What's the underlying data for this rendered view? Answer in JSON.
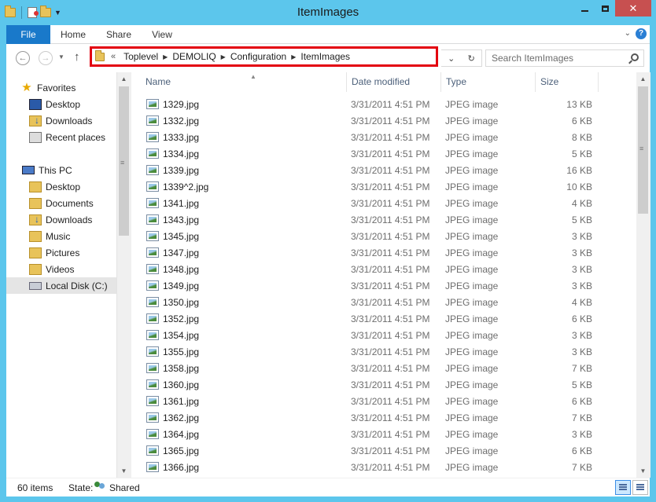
{
  "window": {
    "title": "ItemImages",
    "controls": {
      "minimize": "–",
      "maximize": "□",
      "close": "✕"
    }
  },
  "ribbon": {
    "tabs": [
      "File",
      "Home",
      "Share",
      "View"
    ],
    "expand_glyph": "⌄",
    "help_glyph": "?"
  },
  "address": {
    "overflow": "«",
    "crumbs": [
      "Toplevel",
      "DEMOLIQ",
      "Configuration",
      "ItemImages"
    ],
    "search_placeholder": "Search ItemImages",
    "highlight_color": "#e3000f"
  },
  "nav": {
    "favorites_label": "Favorites",
    "favorites": [
      "Desktop",
      "Downloads",
      "Recent places"
    ],
    "this_pc_label": "This PC",
    "this_pc": [
      "Desktop",
      "Documents",
      "Downloads",
      "Music",
      "Pictures",
      "Videos",
      "Local Disk (C:)"
    ],
    "selected": "Local Disk (C:)"
  },
  "columns": {
    "name": "Name",
    "date": "Date modified",
    "type": "Type",
    "size": "Size"
  },
  "files": [
    {
      "name": "1329.jpg",
      "date": "3/31/2011 4:51 PM",
      "type": "JPEG image",
      "size": "13 KB"
    },
    {
      "name": "1332.jpg",
      "date": "3/31/2011 4:51 PM",
      "type": "JPEG image",
      "size": "6 KB"
    },
    {
      "name": "1333.jpg",
      "date": "3/31/2011 4:51 PM",
      "type": "JPEG image",
      "size": "8 KB"
    },
    {
      "name": "1334.jpg",
      "date": "3/31/2011 4:51 PM",
      "type": "JPEG image",
      "size": "5 KB"
    },
    {
      "name": "1339.jpg",
      "date": "3/31/2011 4:51 PM",
      "type": "JPEG image",
      "size": "16 KB"
    },
    {
      "name": "1339^2.jpg",
      "date": "3/31/2011 4:51 PM",
      "type": "JPEG image",
      "size": "10 KB"
    },
    {
      "name": "1341.jpg",
      "date": "3/31/2011 4:51 PM",
      "type": "JPEG image",
      "size": "4 KB"
    },
    {
      "name": "1343.jpg",
      "date": "3/31/2011 4:51 PM",
      "type": "JPEG image",
      "size": "5 KB"
    },
    {
      "name": "1345.jpg",
      "date": "3/31/2011 4:51 PM",
      "type": "JPEG image",
      "size": "3 KB"
    },
    {
      "name": "1347.jpg",
      "date": "3/31/2011 4:51 PM",
      "type": "JPEG image",
      "size": "3 KB"
    },
    {
      "name": "1348.jpg",
      "date": "3/31/2011 4:51 PM",
      "type": "JPEG image",
      "size": "3 KB"
    },
    {
      "name": "1349.jpg",
      "date": "3/31/2011 4:51 PM",
      "type": "JPEG image",
      "size": "3 KB"
    },
    {
      "name": "1350.jpg",
      "date": "3/31/2011 4:51 PM",
      "type": "JPEG image",
      "size": "4 KB"
    },
    {
      "name": "1352.jpg",
      "date": "3/31/2011 4:51 PM",
      "type": "JPEG image",
      "size": "6 KB"
    },
    {
      "name": "1354.jpg",
      "date": "3/31/2011 4:51 PM",
      "type": "JPEG image",
      "size": "3 KB"
    },
    {
      "name": "1355.jpg",
      "date": "3/31/2011 4:51 PM",
      "type": "JPEG image",
      "size": "3 KB"
    },
    {
      "name": "1358.jpg",
      "date": "3/31/2011 4:51 PM",
      "type": "JPEG image",
      "size": "7 KB"
    },
    {
      "name": "1360.jpg",
      "date": "3/31/2011 4:51 PM",
      "type": "JPEG image",
      "size": "5 KB"
    },
    {
      "name": "1361.jpg",
      "date": "3/31/2011 4:51 PM",
      "type": "JPEG image",
      "size": "6 KB"
    },
    {
      "name": "1362.jpg",
      "date": "3/31/2011 4:51 PM",
      "type": "JPEG image",
      "size": "7 KB"
    },
    {
      "name": "1364.jpg",
      "date": "3/31/2011 4:51 PM",
      "type": "JPEG image",
      "size": "3 KB"
    },
    {
      "name": "1365.jpg",
      "date": "3/31/2011 4:51 PM",
      "type": "JPEG image",
      "size": "6 KB"
    },
    {
      "name": "1366.jpg",
      "date": "3/31/2011 4:51 PM",
      "type": "JPEG image",
      "size": "7 KB"
    }
  ],
  "status": {
    "item_count": "60 items",
    "state_label": "State:",
    "state_value": "Shared"
  }
}
